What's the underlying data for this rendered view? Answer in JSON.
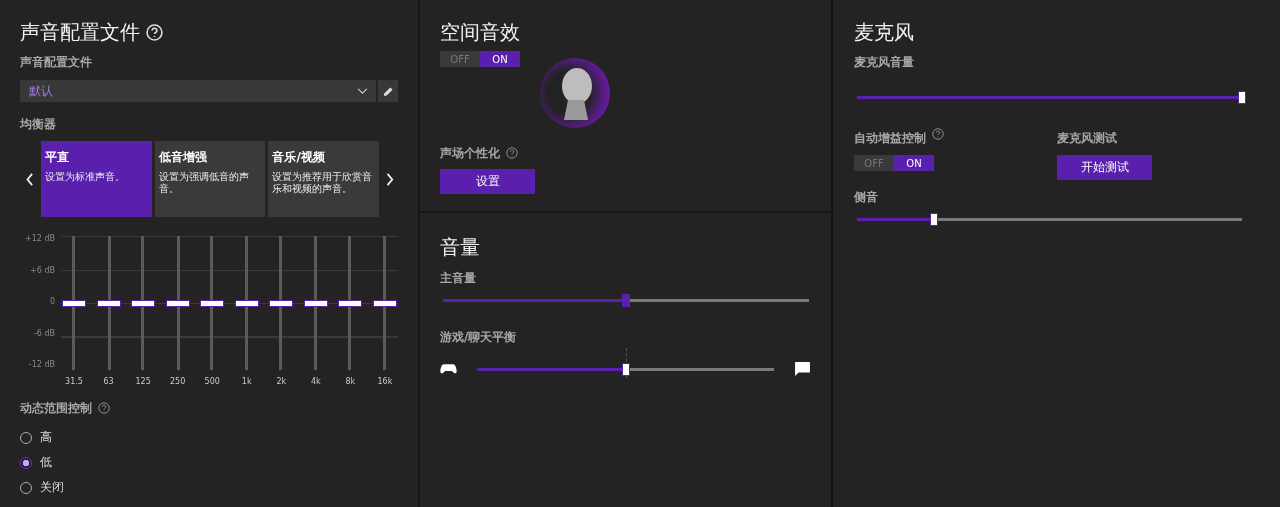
{
  "sound_profile": {
    "title": "声音配置文件",
    "profile_label": "声音配置文件",
    "profile_value": "默认",
    "equalizer_label": "均衡器",
    "presets": [
      {
        "title": "平直",
        "description": "设置为标准声音。",
        "selected": true
      },
      {
        "title": "低音增强",
        "description": "设置为强调低音的声音。",
        "selected": false
      },
      {
        "title": "音乐/视频",
        "description": "设置为推荐用于欣赏音乐和视频的声音。",
        "selected": false
      }
    ],
    "eq_scale": [
      "+12 dB",
      "+6 dB",
      "0",
      "-6 dB",
      "-12 dB"
    ],
    "eq_bands": [
      {
        "label": "31.5",
        "level": 0.5
      },
      {
        "label": "63",
        "level": 0.5
      },
      {
        "label": "125",
        "level": 0.5
      },
      {
        "label": "250",
        "level": 0.5
      },
      {
        "label": "500",
        "level": 0.5
      },
      {
        "label": "1k",
        "level": 0.5
      },
      {
        "label": "2k",
        "level": 0.5
      },
      {
        "label": "4k",
        "level": 0.5
      },
      {
        "label": "8k",
        "level": 0.5
      },
      {
        "label": "16k",
        "level": 0.5
      }
    ],
    "dynamic_range_label": "动态范围控制",
    "dynamic_range_options": [
      {
        "label": "高",
        "selected": false
      },
      {
        "label": "低",
        "selected": true
      },
      {
        "label": "关闭",
        "selected": false
      }
    ]
  },
  "spatial_sound": {
    "title": "空间音效",
    "toggle": {
      "off_label": "OFF",
      "on_label": "ON",
      "on": true
    },
    "personalize_label": "声场个性化",
    "setup_button": "设置"
  },
  "volume": {
    "title": "音量",
    "master": {
      "label": "主音量",
      "level": 0.5
    },
    "balance": {
      "label": "游戏/聊天平衡",
      "level": 0.5
    }
  },
  "microphone": {
    "title": "麦克风",
    "mic_volume": {
      "label": "麦克风音量",
      "level": 1.0
    },
    "agc_label": "自动增益控制",
    "agc_toggle": {
      "off_label": "OFF",
      "on_label": "ON",
      "on": true
    },
    "test_label": "麦克风测试",
    "test_button": "开始测试",
    "sidetone": {
      "label": "侧音",
      "level": 0.2
    }
  }
}
